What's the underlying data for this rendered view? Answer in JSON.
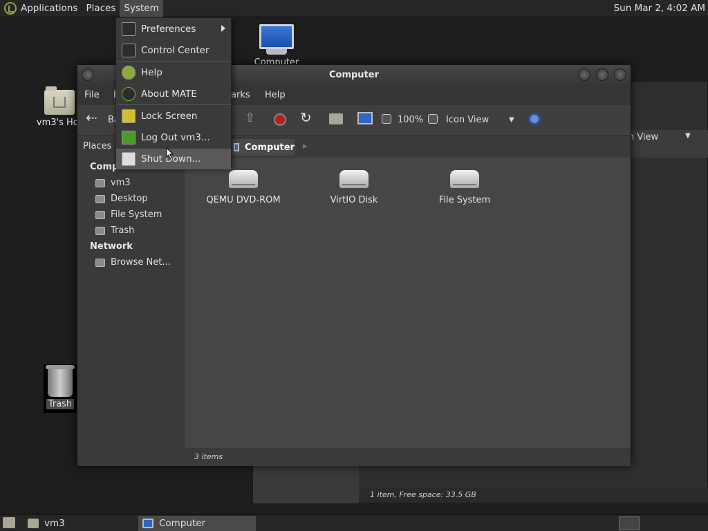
{
  "top_panel": {
    "applications": "Applications",
    "places": "Places",
    "system": "System",
    "clock": "Sun Mar  2,  4:02 AM"
  },
  "desktop": {
    "home_label": "vm3's Hor",
    "computer_label": "Computer",
    "trash_label": "Trash"
  },
  "window": {
    "title": "Computer",
    "menu": [
      "File",
      "E",
      "arks",
      "Help"
    ],
    "back_label": "Ba",
    "zoom": "100%",
    "view_mode": "Icon View",
    "places_label": "Places",
    "path_current": "Computer",
    "sidebar": {
      "computer_header": "Computer",
      "items": [
        "vm3",
        "Desktop",
        "File System",
        "Trash"
      ],
      "network_header": "Network",
      "network_items": [
        "Browse Net..."
      ]
    },
    "drives": [
      "QEMU DVD-ROM",
      "VirtIO Disk",
      "File System"
    ],
    "status": "3 items"
  },
  "back_window": {
    "view_mode": "on View",
    "status": "1 item, Free space: 33.5 GB"
  },
  "system_menu": {
    "items": [
      "Preferences",
      "Control Center",
      "Help",
      "About MATE",
      "Lock Screen",
      "Log Out vm3...",
      "Shut Down..."
    ]
  },
  "bottom_panel": {
    "tasks": [
      "vm3",
      "Computer"
    ]
  }
}
